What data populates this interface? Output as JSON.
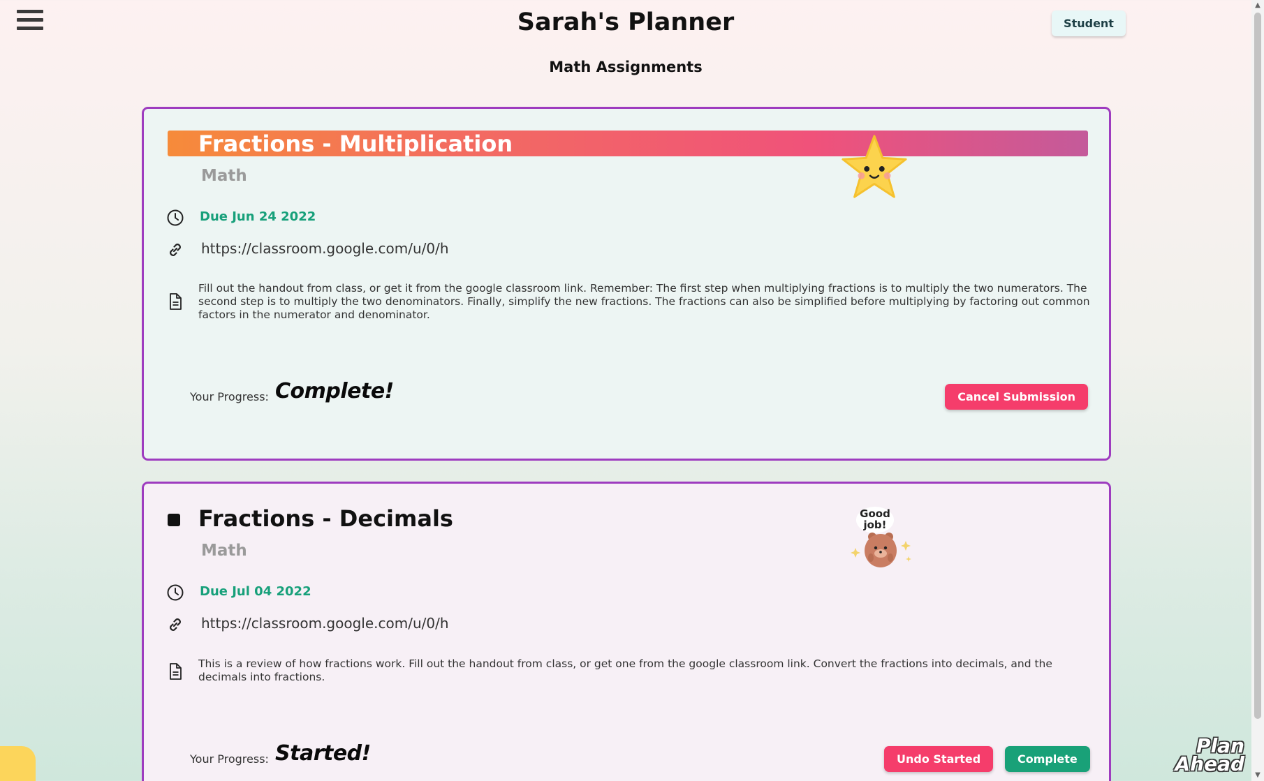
{
  "header": {
    "title": "Sarah's Planner",
    "role_label": "Student"
  },
  "section": {
    "title": "Math Assignments"
  },
  "assignments": [
    {
      "title": "Fractions - Multiplication",
      "subject": "Math",
      "due": "Due Jun 24 2022",
      "link": "https://classroom.google.com/u/0/h",
      "description": "Fill out the handout from class, or get it from the google classroom link. Remember: The first step when multiplying fractions is to multiply the two numerators. The second step is to multiply the two denominators. Finally, simplify the new fractions. The fractions can also be simplified before multiplying by factoring out common factors in the numerator and denominator.",
      "progress_label": "Your Progress:",
      "progress_value": "Complete!",
      "buttons": [
        {
          "label": "Cancel Submission"
        }
      ]
    },
    {
      "title": "Fractions - Decimals",
      "subject": "Math",
      "due": "Due Jul 04 2022",
      "link": "https://classroom.google.com/u/0/h",
      "description": "This is a review of how fractions work. Fill out the handout from class, or get one from the google classroom link. Convert the fractions into decimals, and the decimals into fractions.",
      "progress_label": "Your Progress:",
      "progress_value": "Started!",
      "buttons": [
        {
          "label": "Undo Started"
        },
        {
          "label": "Complete"
        }
      ]
    }
  ],
  "stickers": {
    "bear_text_line1": "Good",
    "bear_text_line2": "job!"
  },
  "logo": {
    "line1": "Plan",
    "line2": "Ahead"
  },
  "colors": {
    "card_border": "#9e3cbf",
    "due_date": "#17a07a",
    "danger_button": "#f53d6b",
    "success_button": "#19a178",
    "title_gradient_start": "#f68b3a",
    "title_gradient_end": "#c45a9a"
  },
  "icons": {
    "menu": "hamburger-menu-icon",
    "due": "clock-icon",
    "link": "link-icon",
    "description": "document-icon",
    "sticker_1": "star-sticker-icon",
    "sticker_2": "bear-sticker-icon"
  }
}
